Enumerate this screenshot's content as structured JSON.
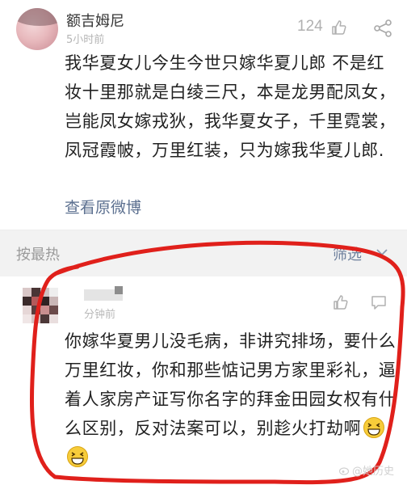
{
  "post": {
    "username": "额吉姆尼",
    "time": "5小时前",
    "likes": "124",
    "body": "我华夏女儿今生今世只嫁华夏儿郎 不是红妆十里那就是白绫三尺，本是龙男配凤女，岂能凤女嫁戎狄，我华夏女子，千里霓裳，凤冠霞帔，万里红装，只为嫁我华夏儿郎.",
    "link": "查看原微博"
  },
  "sortbar": {
    "sort_label": "按最热",
    "filter_label": "筛选"
  },
  "comment": {
    "time": "分钟前",
    "body": "你嫁华夏男儿没毛病，非讲究排场，要什么万里红妆，你和那些惦记男方家里彩礼，逼着人家房产证写你名字的拜金田园女权有什么区别，反对法案可以，别趁火打劫啊"
  },
  "watermark": "@她历史",
  "icons": {
    "like": "thumbs-up-icon",
    "share": "share-icon",
    "caret": "chevron-down-icon",
    "emoji": "grinning-emoji-icon"
  },
  "colors": {
    "link": "#5b6f8f",
    "sortbar_bg": "#f2f2f2",
    "annotation": "#e0201b"
  }
}
